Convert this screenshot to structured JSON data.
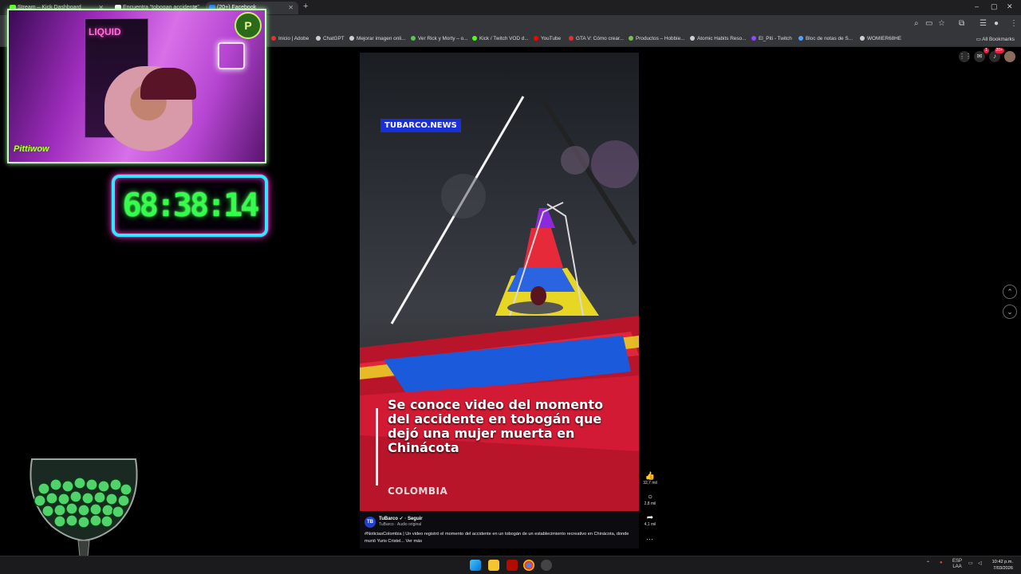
{
  "browser": {
    "tabs": [
      {
        "label": "Stream – Kick Dashboard",
        "active": false
      },
      {
        "label": "Encuentra “tobogan accidente”",
        "active": false
      },
      {
        "label": "(20+) Facebook",
        "active": true
      }
    ],
    "new_tab": "+",
    "window_controls": [
      "–",
      "▢",
      "✕"
    ],
    "bookmarks": [
      {
        "label": "Inicio | Adobe",
        "color": "#e0332e"
      },
      {
        "label": "ChatGPT",
        "color": "#cfcfcf"
      },
      {
        "label": "Mejorar imagen onli...",
        "color": "#cfcfcf"
      },
      {
        "label": "Ver Rick y Morty – o...",
        "color": "#5ec257"
      },
      {
        "label": "Kick / Twitch VOD d...",
        "color": "#53fc18"
      },
      {
        "label": "YouTube",
        "color": "#ff0000"
      },
      {
        "label": "GTA V: Cómo crear...",
        "color": "#e0332e"
      },
      {
        "label": "Productos – Hobbie...",
        "color": "#7bbf4a"
      },
      {
        "label": "Atomic Habits Reso...",
        "color": "#cfcfcf"
      },
      {
        "label": "El_Piti - Twitch",
        "color": "#9146ff"
      },
      {
        "label": "Bloc de notas de S...",
        "color": "#4aa3ff"
      },
      {
        "label": "WOMIER68HE",
        "color": "#cfcfcf"
      }
    ],
    "all_bookmarks": "All Bookmarks"
  },
  "facebook": {
    "notif_badge": "1",
    "notif_badge2": "20+"
  },
  "stream": {
    "timer": "68:38:14",
    "brand": "Pittiwow",
    "logo_letter": "P",
    "neon_text": "LIQUID"
  },
  "reel": {
    "news_tag": "TUBARCO.NEWS",
    "headline": "Se conoce video del momento del accidente en tobogán que dejó una mujer muerta en Chinácota",
    "region": "COLOMBIA",
    "author": "TuBarco",
    "follow": "Seguir",
    "audio": "TuBarco · Audio original",
    "caption": "#NoticiasColombia | Un video registró el momento del accidente en un tobogán de un establecimiento recreativo en Chinácota, donde murió Yuris Cristel... Ver más",
    "likes": "32,7 mil",
    "comments": "2,8 mil",
    "shares": "4,1 mil",
    "more": "···"
  },
  "taskbar": {
    "lang": "ESP",
    "lang2": "LAA",
    "time": "10:42 p.m.",
    "date": "7/03/2026"
  }
}
